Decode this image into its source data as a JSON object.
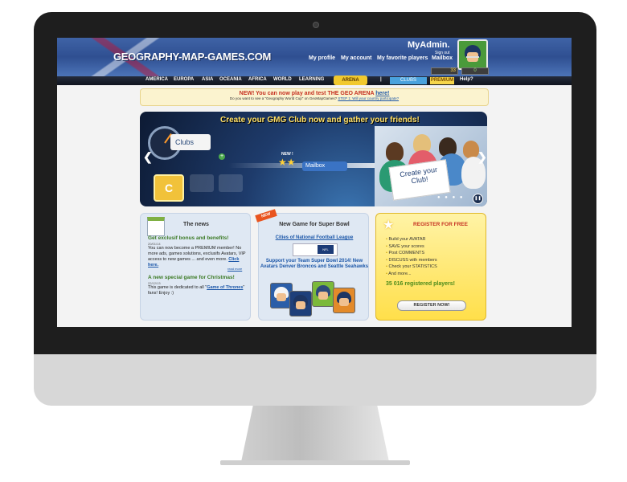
{
  "header": {
    "logo": "GEOGRAPHY-MAP-GAMES.COM",
    "user_name": "MyAdmin.",
    "sign_out": "Sign out",
    "links": [
      "My profile",
      "My account",
      "My favorite players"
    ],
    "mailbox": "Mailbox",
    "coins": "33",
    "counter": "0"
  },
  "nav": {
    "items": [
      "AMERICA",
      "EUROPA",
      "ASIA",
      "OCEANIA",
      "AFRICA",
      "WORLD",
      "LEARNING"
    ],
    "arena": "ARENA",
    "separator": "|",
    "clubs": "CLUBS",
    "premium": "PREMIUM",
    "help": "Help?"
  },
  "notice": {
    "line1_text": "NEW! You can now play and test THE GEO ARENA",
    "line1_link": "here!",
    "line2_text": "Do you want to see a \"Geography World Cup\" on GeoMapGames?",
    "line2_link": "STEP 1: Will your country participate?"
  },
  "banner": {
    "title": "Create your GMG Club now and gather your friends!",
    "clubs_tag": "Clubs",
    "new_label": "NEW !",
    "mailbox": "Mailbox",
    "sign": "Create your Club!",
    "gold_letter": "C"
  },
  "news": {
    "heading": "The news",
    "item1_title": "Get exclusif bonus and benefits!",
    "item1_date": "20/01/14",
    "item1_body": "You can now become a PREMIUM member! No more ads, games solutions, exclusifs Avatars, VIP access to new games ... and even more.",
    "item1_link": "Click here.",
    "read_more": "read more",
    "item2_title": "A new special game for Christmas!",
    "item2_date": "22/12/13",
    "item2_body": "This game is dedicated to all \"",
    "item2_link": "Game of Thrones",
    "item2_tail": "\" fans! Enjoy :)"
  },
  "superbowl": {
    "ribbon": "NEW",
    "heading": "New Game for Super Bowl",
    "link": "Cities of National Football League",
    "nfl_label": "NFL",
    "support": "Support your Team Super Bowl 2014! New Avatars Denver Broncos and Seattle Seahawks"
  },
  "register": {
    "heading": "REGISTER FOR FREE",
    "items": [
      "Build your AVATAR",
      "SAVE your scores",
      "Post COMMENTS",
      "DISCUSS with members",
      "Check your STATISTICS",
      "And more..."
    ],
    "count": "35 016 registered players!",
    "button": "REGISTER NOW!"
  },
  "colors": {
    "header_blue": "#2f4f91",
    "accent_gold": "#f1c92e",
    "news_green": "#3b7a24",
    "link_blue": "#1b56a8",
    "alert_red": "#c53021"
  }
}
